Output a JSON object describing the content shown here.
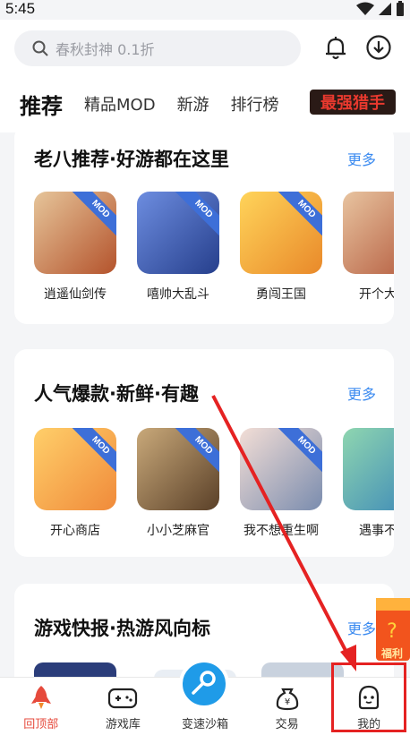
{
  "status": {
    "time": "5:45"
  },
  "search": {
    "placeholder": "春秋封神   0.1折"
  },
  "tabs": [
    {
      "label": "推荐"
    },
    {
      "label": "精品MOD"
    },
    {
      "label": "新游"
    },
    {
      "label": "排行榜"
    }
  ],
  "tab_logo_text": "最强猎手",
  "sections": [
    {
      "title": "老八推荐·好游都在这里",
      "more": "更多",
      "games": [
        {
          "name": "逍遥仙剑传",
          "badge": "MOD",
          "color": "#c86b3a"
        },
        {
          "name": "嘻帅大乱斗",
          "badge": "MOD",
          "color": "#3f5fb8"
        },
        {
          "name": "勇闯王国",
          "badge": "MOD",
          "color": "#f2b32b"
        },
        {
          "name": "开个大工",
          "badge": "",
          "color": "#d69a74"
        }
      ]
    },
    {
      "title": "人气爆款·新鲜·有趣",
      "more": "更多",
      "games": [
        {
          "name": "开心商店",
          "badge": "MOD",
          "color": "#f3a63c"
        },
        {
          "name": "小小芝麻官",
          "badge": "MOD",
          "color": "#8a6a45"
        },
        {
          "name": "我不想重生啊",
          "badge": "MOD",
          "color": "#5a6f9a"
        },
        {
          "name": "遇事不要",
          "badge": "",
          "color": "#4fb0a0"
        }
      ]
    },
    {
      "title": "游戏快报·热游风向标",
      "more": "更多",
      "badge_text": "福利"
    }
  ],
  "bottom_nav": [
    {
      "label": "回顶部",
      "icon": "rocket-icon"
    },
    {
      "label": "游戏库",
      "icon": "gamepad-icon"
    },
    {
      "label": "变速沙箱",
      "icon": "key-icon"
    },
    {
      "label": "交易",
      "icon": "money-bag-icon"
    },
    {
      "label": "我的",
      "icon": "profile-face-icon"
    }
  ],
  "colors": {
    "accent": "#3a8af0",
    "active_nav": "#e64a3c",
    "highlight": "#e52222"
  }
}
